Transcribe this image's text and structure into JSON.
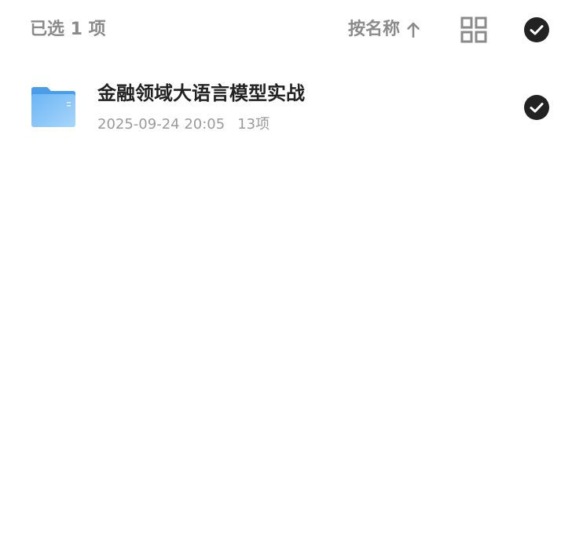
{
  "toolbar": {
    "selection_count": "已选 1 项",
    "sort_label": "按名称",
    "sort_direction_icon": "arrow-up-icon",
    "grid_view_icon": "grid-view-icon",
    "select_all_icon": "check-circle-icon"
  },
  "files": [
    {
      "name": "金融领域大语言模型实战",
      "date": "2025-09-24 20:05",
      "count": "13项",
      "type_icon": "folder-icon",
      "selected": true
    }
  ],
  "colors": {
    "check_fill": "#222222",
    "muted_text": "#8a8a8a",
    "folder_blue": "#5aaaf0"
  }
}
